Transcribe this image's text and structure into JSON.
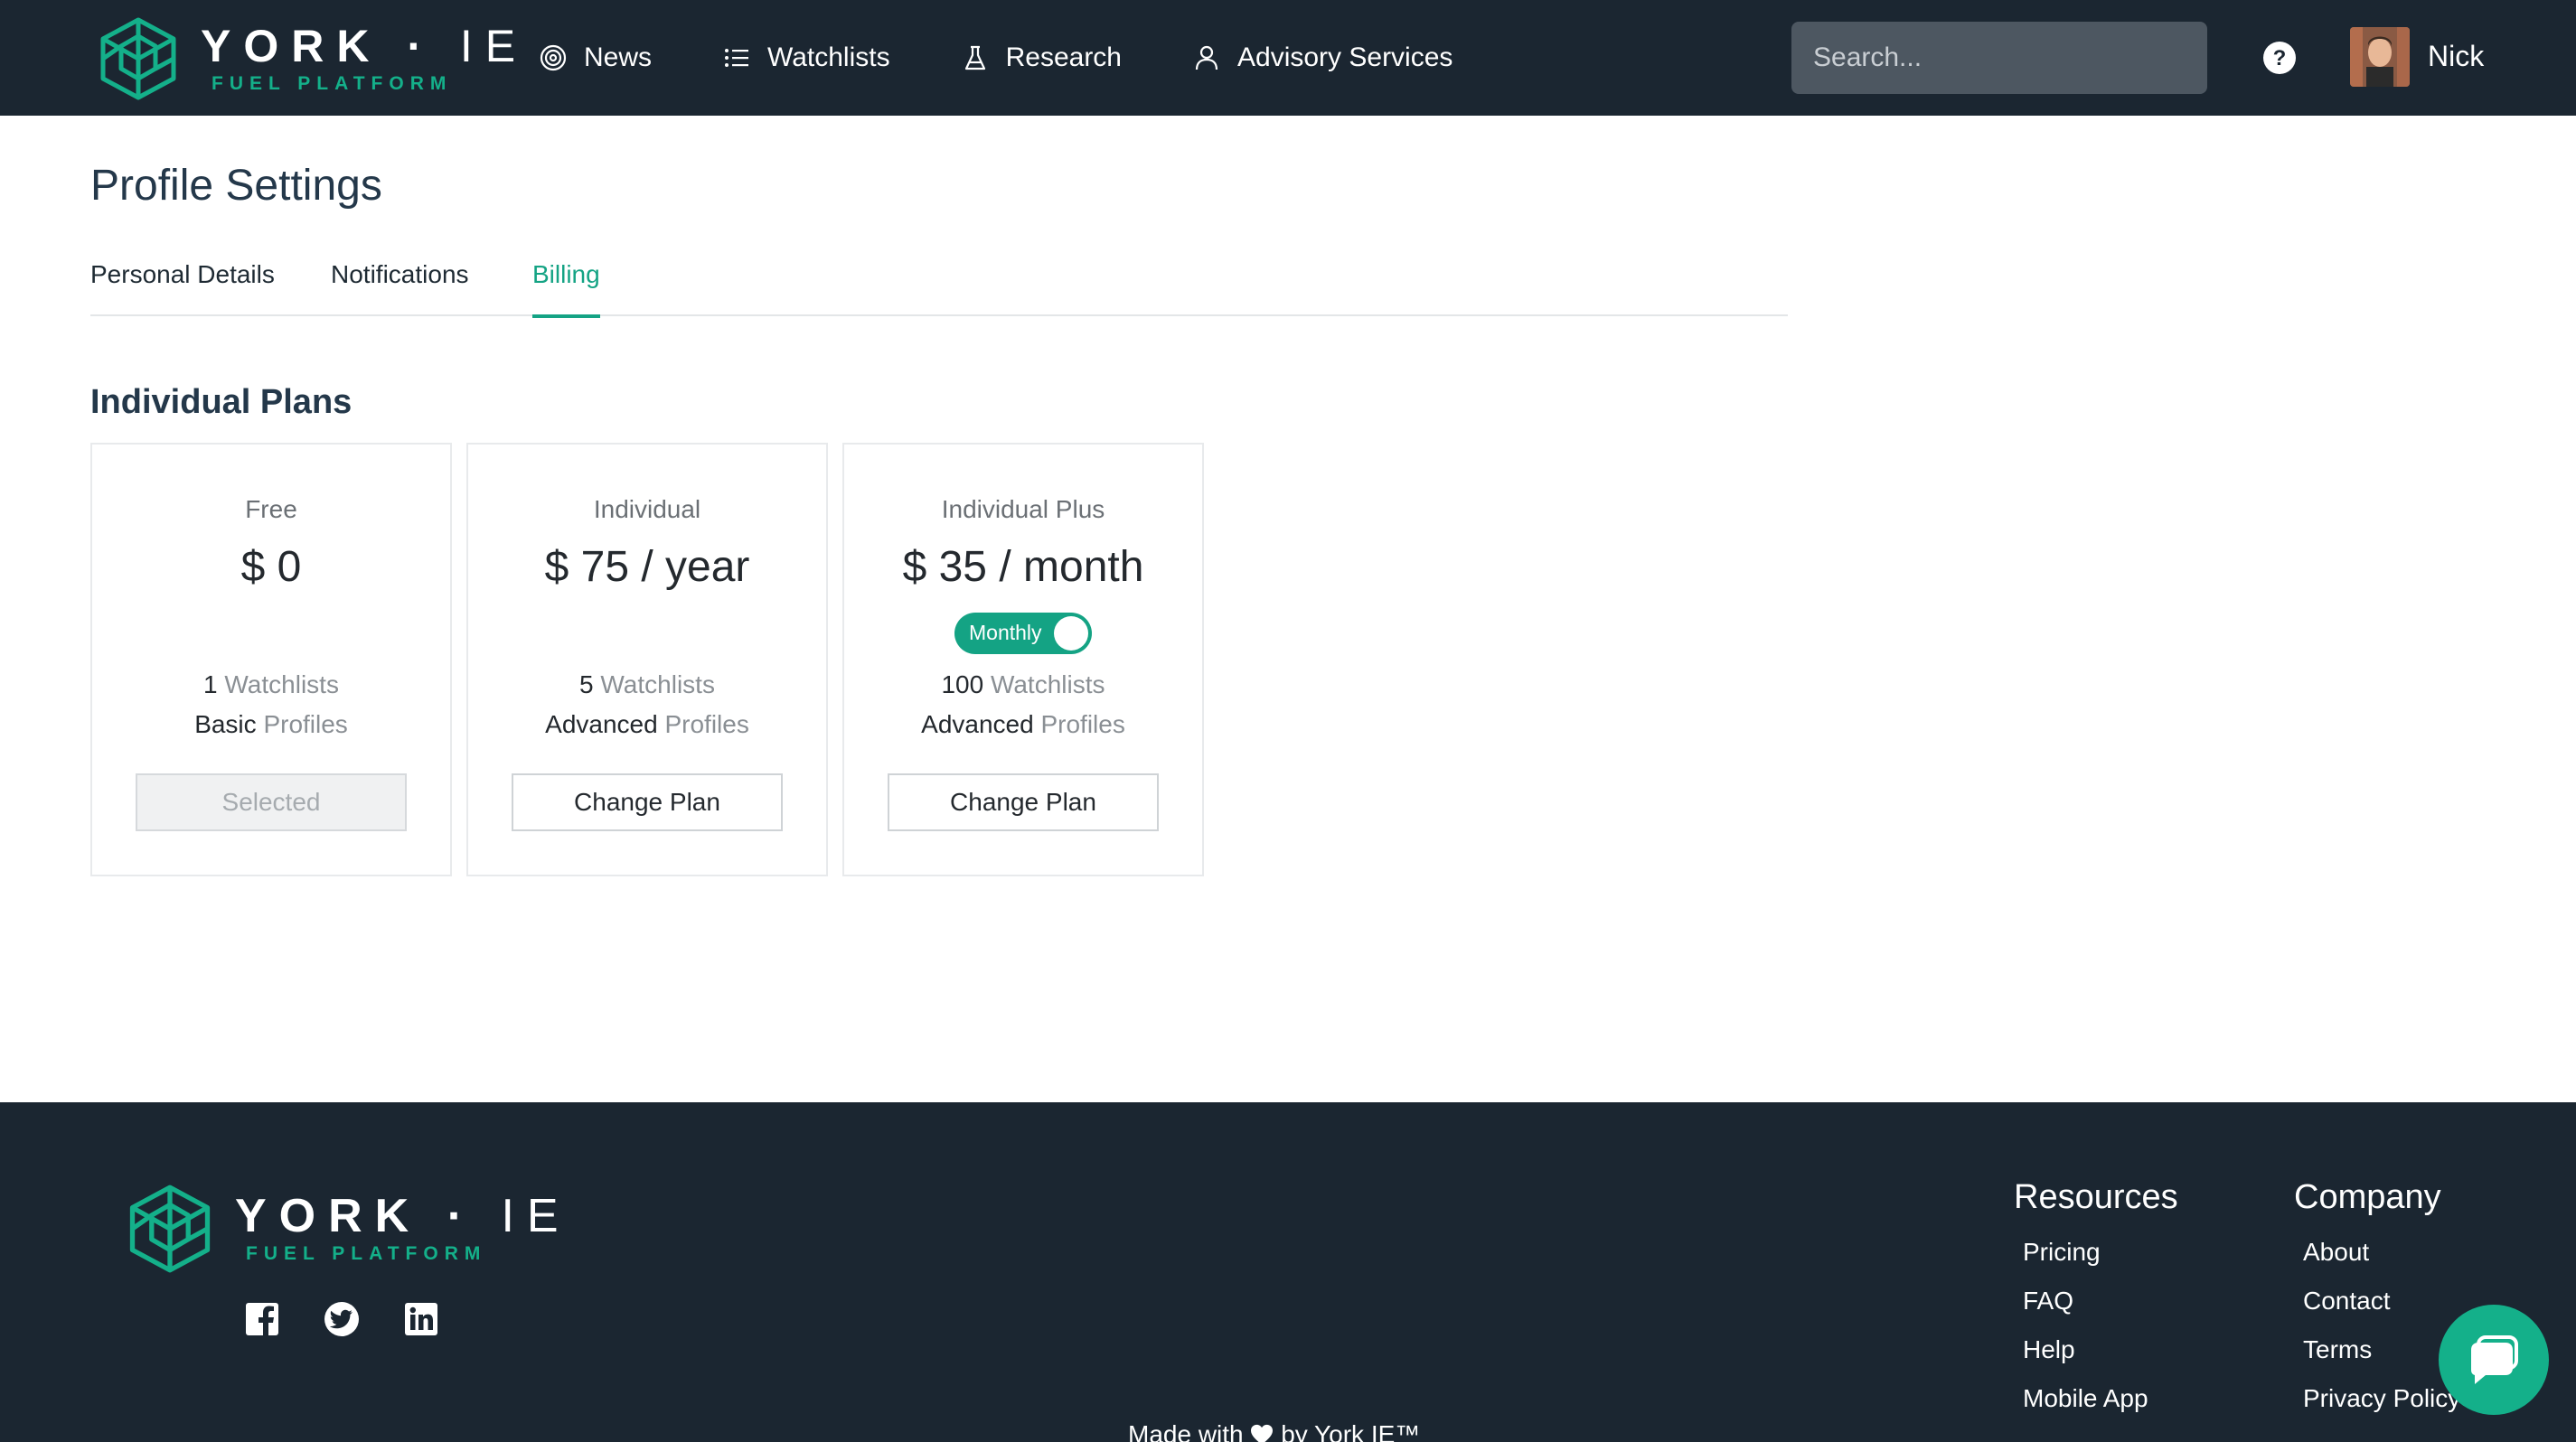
{
  "brand": {
    "name": "YORK",
    "name_suffix": "IE",
    "sub": "FUEL PLATFORM"
  },
  "nav": {
    "items": [
      {
        "label": "News",
        "icon": "news-target-icon"
      },
      {
        "label": "Watchlists",
        "icon": "list-icon"
      },
      {
        "label": "Research",
        "icon": "flask-icon"
      },
      {
        "label": "Advisory Services",
        "icon": "user-icon"
      }
    ],
    "search_placeholder": "Search...",
    "user_name": "Nick"
  },
  "page": {
    "title": "Profile Settings",
    "tabs": [
      {
        "label": "Personal Details",
        "active": false
      },
      {
        "label": "Notifications",
        "active": false
      },
      {
        "label": "Billing",
        "active": true
      }
    ],
    "section_title": "Individual Plans"
  },
  "plans": [
    {
      "name": "Free",
      "price": "$ 0",
      "watchlists_count": "1",
      "watchlists_label": "Watchlists",
      "profiles_level": "Basic",
      "profiles_label": "Profiles",
      "button": "Selected",
      "selected": true
    },
    {
      "name": "Individual",
      "price": "$ 75 / year",
      "watchlists_count": "5",
      "watchlists_label": "Watchlists",
      "profiles_level": "Advanced",
      "profiles_label": "Profiles",
      "button": "Change Plan",
      "selected": false
    },
    {
      "name": "Individual Plus",
      "price": "$ 35 / month",
      "toggle_label": "Monthly",
      "watchlists_count": "100",
      "watchlists_label": "Watchlists",
      "profiles_level": "Advanced",
      "profiles_label": "Profiles",
      "button": "Change Plan",
      "selected": false
    }
  ],
  "footer": {
    "resources_title": "Resources",
    "resources": [
      "Pricing",
      "FAQ",
      "Help",
      "Mobile App"
    ],
    "company_title": "Company",
    "company": [
      "About",
      "Contact",
      "Terms",
      "Privacy Policy"
    ],
    "made_with_prefix": "Made with",
    "made_with_suffix": "by York IE™"
  },
  "colors": {
    "nav_bg": "#1b2631",
    "accent": "#14a384",
    "title": "#24384a"
  }
}
